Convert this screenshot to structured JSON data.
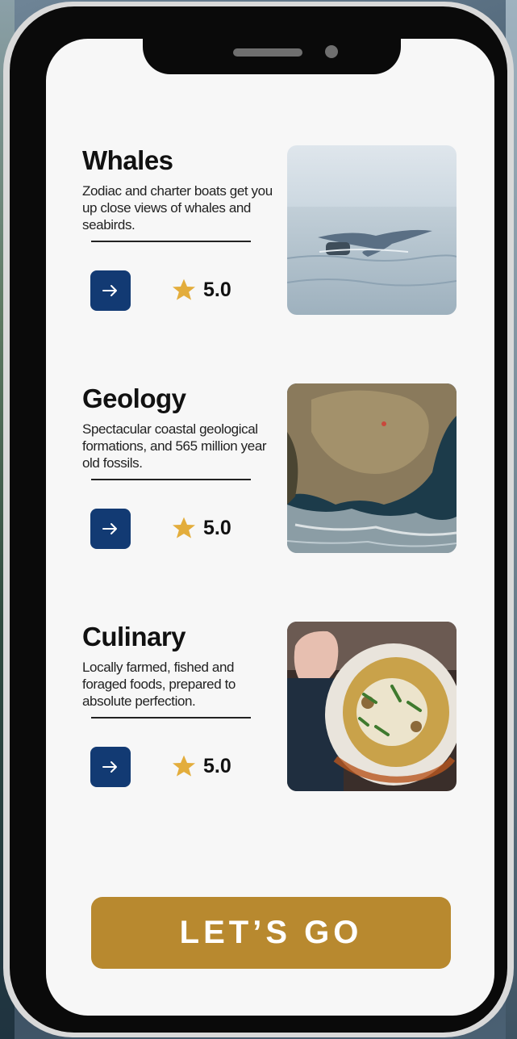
{
  "colors": {
    "accent_blue": "#123a73",
    "accent_gold": "#b8892f",
    "star": "#e3ad3c",
    "screen_bg": "#f7f7f7",
    "text": "#111111"
  },
  "cards": [
    {
      "title": "Whales",
      "description": "Zodiac and charter boats get you up close views of whales and seabirds.",
      "arrow_icon": "arrow-right-icon",
      "star_icon": "star-icon",
      "rating": "5.0",
      "photo": "whale-tail-photo"
    },
    {
      "title": "Geology",
      "description": "Spectacular coastal geological formations, and 565 million year old fossils.",
      "arrow_icon": "arrow-right-icon",
      "star_icon": "star-icon",
      "rating": "5.0",
      "photo": "coastal-rocks-photo"
    },
    {
      "title": "Culinary",
      "description": "Locally farmed, fished and foraged foods, prepared to absolute perfection.",
      "arrow_icon": "arrow-right-icon",
      "star_icon": "star-icon",
      "rating": "5.0",
      "photo": "seafood-dish-photo"
    }
  ],
  "cta": {
    "label": "LET’S GO"
  }
}
